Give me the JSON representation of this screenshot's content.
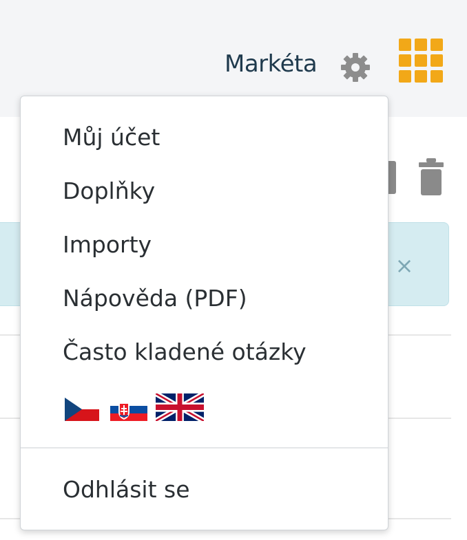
{
  "header": {
    "username": "Markéta",
    "settings_icon": "gear-icon",
    "apps_icon": "grid-icon",
    "accent_color": "#f2a818"
  },
  "toolbar": {
    "delete_icon": "trash-icon"
  },
  "alert": {
    "close_label": "×",
    "background_color": "#d5ecf1"
  },
  "user_menu": {
    "items": [
      {
        "label": "Můj účet"
      },
      {
        "label": "Doplňky"
      },
      {
        "label": "Importy"
      },
      {
        "label": "Nápověda (PDF)"
      },
      {
        "label": "Často kladené otázky"
      }
    ],
    "languages": [
      {
        "name": "cs-flag-icon"
      },
      {
        "name": "sk-flag-icon"
      },
      {
        "name": "gb-flag-icon"
      }
    ],
    "logout_label": "Odhlásit se"
  }
}
